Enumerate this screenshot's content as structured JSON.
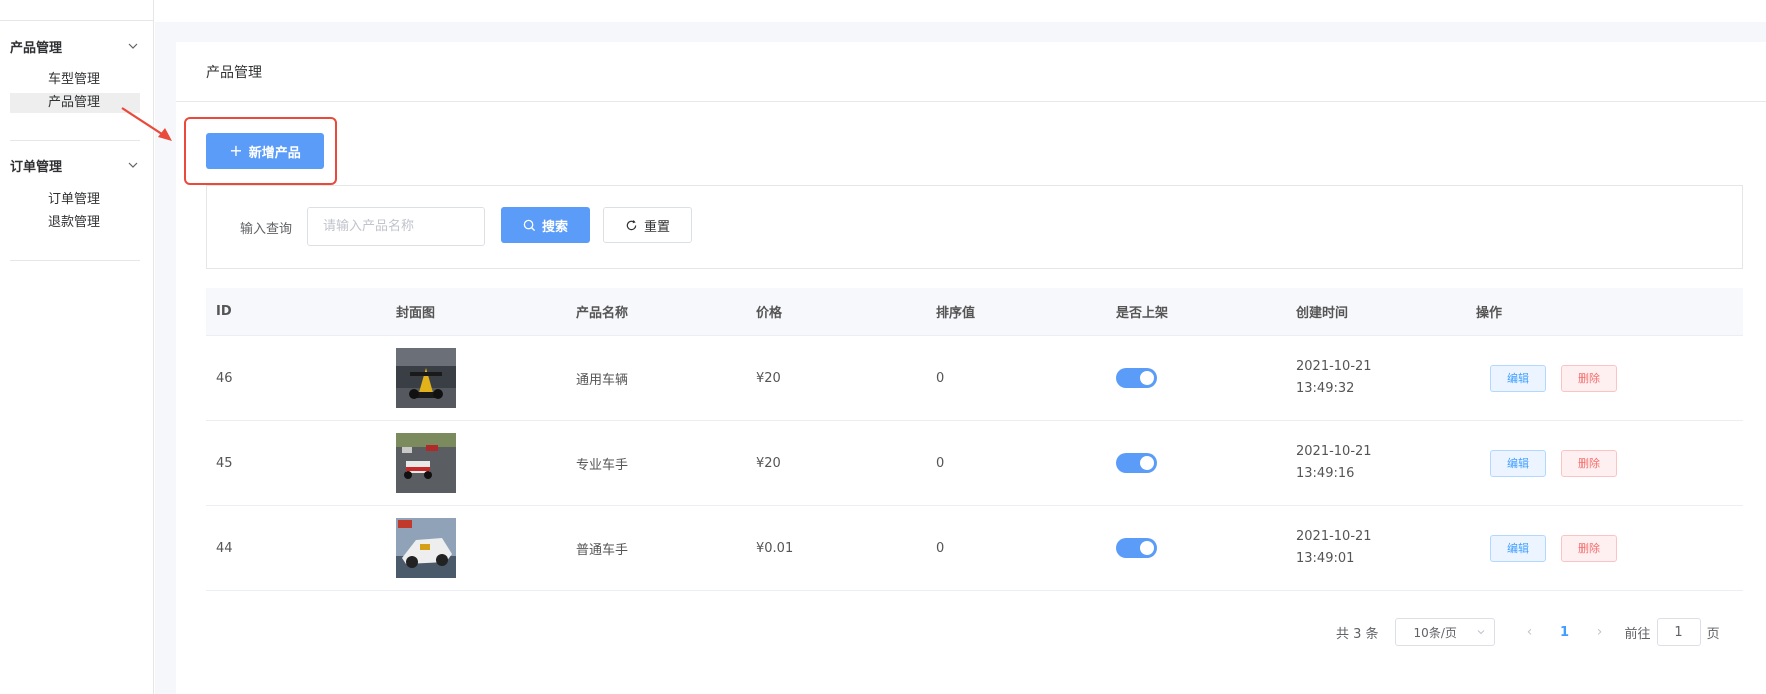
{
  "sidebar": {
    "groups": [
      {
        "label": "产品管理",
        "items": [
          {
            "label": "车型管理"
          },
          {
            "label": "产品管理"
          }
        ]
      },
      {
        "label": "订单管理",
        "items": [
          {
            "label": "订单管理"
          },
          {
            "label": "退款管理"
          }
        ]
      }
    ]
  },
  "card": {
    "title": "产品管理",
    "add_button": "新增产品"
  },
  "search": {
    "label": "输入查询",
    "placeholder": "请输入产品名称",
    "value": "",
    "search_button": "搜索",
    "reset_button": "重置"
  },
  "table": {
    "headers": [
      "ID",
      "封面图",
      "产品名称",
      "价格",
      "排序值",
      "是否上架",
      "创建时间",
      "操作"
    ],
    "rows": [
      {
        "id": "46",
        "name": "通用车辆",
        "price": "¥20",
        "sort": "0",
        "listed": true,
        "date": "2021-10-21",
        "time": "13:49:32",
        "edit": "编辑",
        "delete": "删除"
      },
      {
        "id": "45",
        "name": "专业车手",
        "price": "¥20",
        "sort": "0",
        "listed": true,
        "date": "2021-10-21",
        "time": "13:49:16",
        "edit": "编辑",
        "delete": "删除"
      },
      {
        "id": "44",
        "name": "普通车手",
        "price": "¥0.01",
        "sort": "0",
        "listed": true,
        "date": "2021-10-21",
        "time": "13:49:01",
        "edit": "编辑",
        "delete": "删除"
      }
    ]
  },
  "pagination": {
    "total": "共 3 条",
    "page_size": "10条/页",
    "current": "1",
    "goto_prefix": "前往",
    "goto_value": "1",
    "goto_suffix": "页"
  },
  "colors": {
    "primary": "#5b9cf8",
    "highlight": "#e94a3b",
    "danger": "#f56c6c"
  }
}
